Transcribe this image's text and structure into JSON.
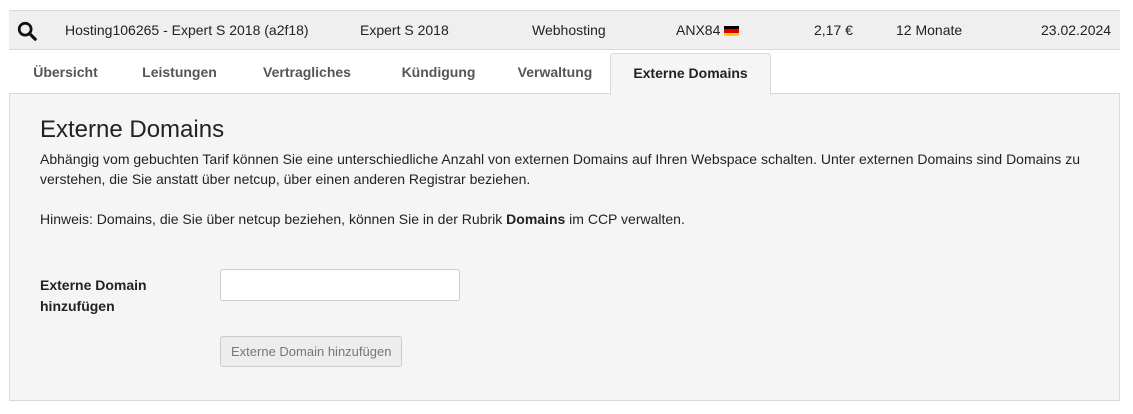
{
  "summary": {
    "product_name": "Hosting106265 - Expert S 2018 (a2f18)",
    "tariff": "Expert S 2018",
    "category": "Webhosting",
    "handle": "ANX84",
    "country_flag_icon": "germany-flag-icon",
    "price": "2,17 €",
    "term": "12 Monate",
    "date": "23.02.2024"
  },
  "tabs": [
    {
      "label": "Übersicht"
    },
    {
      "label": "Leistungen"
    },
    {
      "label": "Vertragliches"
    },
    {
      "label": "Kündigung"
    },
    {
      "label": "Verwaltung"
    },
    {
      "label": "Externe Domains",
      "active": true
    }
  ],
  "section": {
    "title": "Externe Domains",
    "description": "Abhängig vom gebuchten Tarif können Sie eine unterschiedliche Anzahl von externen Domains auf Ihren Webspace schalten. Unter externen Domains sind Domains zu verstehen, die Sie anstatt über netcup, über einen anderen Registrar beziehen.",
    "hint_prefix": "Hinweis: Domains, die Sie über netcup beziehen, können Sie in der Rubrik ",
    "hint_bold": "Domains",
    "hint_suffix": " im CCP verwalten."
  },
  "form": {
    "label": "Externe Domain hinzufügen",
    "input_value": "",
    "input_placeholder": "",
    "button_label": "Externe Domain hinzufügen"
  },
  "colors": {
    "summary_bg": "#efefef",
    "panel_bg": "#f5f5f5",
    "border": "#d9d9d9"
  }
}
